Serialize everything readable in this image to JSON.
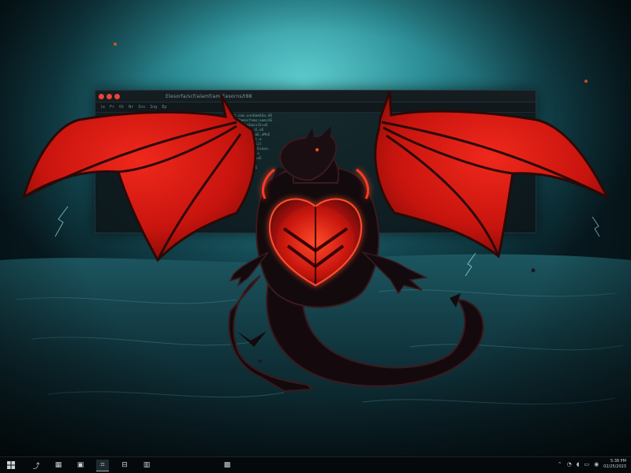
{
  "window": {
    "title": "Elesorfa/scf/alamf/am/Eesorns/t88",
    "toolbar": [
      "(e",
      "Fr",
      "Ot",
      "Nr",
      "Ins",
      "Ing",
      "Ep"
    ],
    "code_lines": [
      "Eat.com.oneEmmSUa.UE",
      "Eat;Pamosfamo;aamsAE",
      "E.msclaloEmsslE+eE",
      "mtnEmsmolEe;E.oE",
      "ESemlsnEm;amaE.oMoE",
      "ECma;mrmas;El.e",
      "E;E8:omEsss.Ecl",
      "Ec;;EmaEm;smtEcmse.",
      "Emm;mEmm;a:aEs",
      "EamEsGEEmsElmsE",
      "EmatsE;EmE",
      "SmmEmEtam+EmE",
      "Emm;E;Em.Em",
      "EEmatEsmsE",
      "E;Smm.E",
      "E5=E:E",
      "EE"
    ]
  },
  "taskbar": {
    "start_icon": "windows-icon",
    "items": [
      {
        "name": "browser",
        "glyph": "⤴"
      },
      {
        "name": "terminal",
        "glyph": "▦"
      },
      {
        "name": "monitor",
        "glyph": "▣"
      },
      {
        "name": "code",
        "glyph": "⌗"
      },
      {
        "name": "editor",
        "glyph": "⊟"
      },
      {
        "name": "files",
        "glyph": "▥"
      },
      {
        "name": "settings",
        "glyph": "▩"
      }
    ],
    "tray": {
      "time": "5:38 PM",
      "date": "02/25/2023"
    }
  },
  "colors": {
    "dragon_red": "#d81a12",
    "dragon_glow": "#ff3a20",
    "dragon_body": "#120a0d",
    "sky": "#3fb2b8",
    "sea": "#10343b"
  }
}
